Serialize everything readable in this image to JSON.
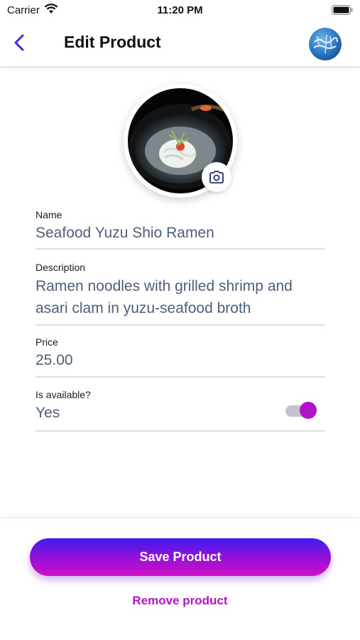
{
  "status_bar": {
    "carrier": "Carrier",
    "time": "11:20 PM"
  },
  "nav": {
    "title": "Edit Product",
    "back_icon": "chevron-left-icon",
    "avatar_icon": "store-logo"
  },
  "product_image": {
    "camera_icon": "camera-icon"
  },
  "form": {
    "name": {
      "label": "Name",
      "value": "Seafood Yuzu Shio Ramen"
    },
    "description": {
      "label": "Description",
      "value": "Ramen noodles with grilled shrimp and asari clam in yuzu-seafood broth"
    },
    "price": {
      "label": "Price",
      "value": "25.00"
    },
    "availability": {
      "label": "Is available?",
      "value": "Yes",
      "toggle_on": true
    }
  },
  "actions": {
    "save_label": "Save Product",
    "remove_label": "Remove product"
  },
  "colors": {
    "accent": "#b013c8",
    "gradient_start": "#3d1cf0",
    "gradient_end": "#d010c8",
    "back_arrow": "#3a2ce0",
    "field_value": "#4e5f7a"
  }
}
